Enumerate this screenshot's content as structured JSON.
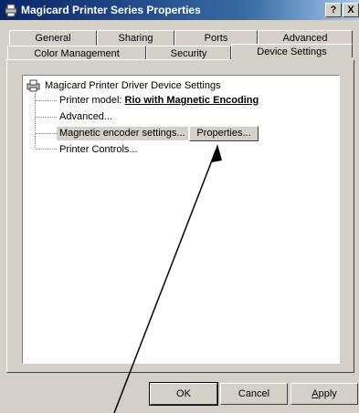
{
  "window": {
    "title": "Magicard Printer Series Properties",
    "help_label": "?",
    "close_label": "X"
  },
  "tabs": {
    "row1": [
      "General",
      "Sharing",
      "Ports",
      "Advanced"
    ],
    "row2": [
      "Color Management",
      "Security",
      "Device Settings"
    ],
    "active": "Device Settings"
  },
  "tree": {
    "root_label": "Magicard Printer Driver Device Settings",
    "model_label": "Printer model:",
    "model_value": "Rio with Magnetic Encoding",
    "advanced_label": "Advanced...",
    "encoder_label": "Magnetic encoder settings...",
    "properties_button": "Properties...",
    "controls_label": "Printer Controls..."
  },
  "buttons": {
    "ok": "OK",
    "cancel": "Cancel",
    "apply": "Apply"
  },
  "colors": {
    "titlebar_start": "#0a246a",
    "titlebar_end": "#a6caf0",
    "face": "#d4d0c8",
    "arrow": "#000000"
  },
  "icons": [
    "printer-icon",
    "help-icon",
    "close-icon",
    "annotation-arrow"
  ]
}
